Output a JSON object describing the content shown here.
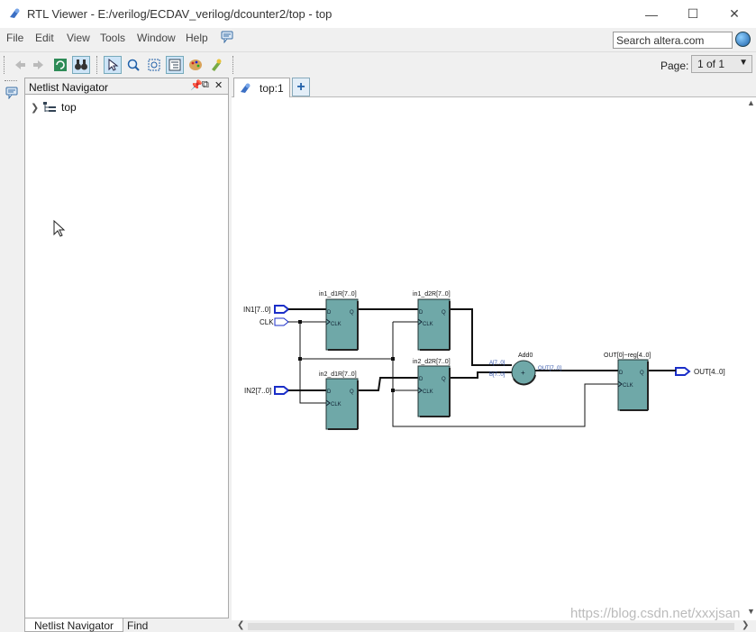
{
  "window": {
    "title": "RTL Viewer - E:/verilog/ECDAV_verilog/dcounter2/top - top",
    "minimize": "—",
    "maximize": "☐",
    "close": "✕"
  },
  "menu": [
    "File",
    "Edit",
    "View",
    "Tools",
    "Window",
    "Help"
  ],
  "search": {
    "value": "Search altera.com"
  },
  "toolbar": {
    "page_label": "Page:",
    "page_value": "1 of 1"
  },
  "navigator": {
    "title": "Netlist Navigator",
    "tree_root": "top",
    "tabs": [
      "Netlist Navigator",
      "Find"
    ]
  },
  "document": {
    "tab_label": "top:1"
  },
  "schematic": {
    "ports": {
      "in1": "IN1[7..0]",
      "clk": "CLK",
      "in2": "IN2[7..0]",
      "out": "OUT[4..0]"
    },
    "registers": {
      "in1_d1": "in1_d1R[7..0]",
      "in1_d2": "in1_d2R[7..0]",
      "in2_d1": "in2_d1R[7..0]",
      "in2_d2": "in2_d2R[7..0]",
      "out_reg": "OUT[0]~reg[4..0]"
    },
    "adder": {
      "name": "Add0",
      "in_a": "A[7..0]",
      "in_b": "B[7..0]",
      "out": "OUT[7..0]",
      "symbol": "+"
    },
    "pins": {
      "d": "D",
      "q": "Q",
      "clk": "CLK"
    }
  },
  "watermark": "https://blog.csdn.net/xxxjsan",
  "colors": {
    "register_fill": "#6fa8a8",
    "port_outline": "#1a2ec8",
    "selected_tool": "#cde4f7"
  }
}
